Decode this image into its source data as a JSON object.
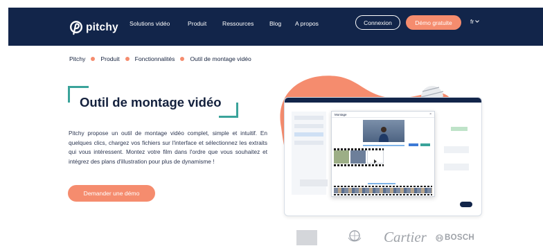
{
  "header": {
    "logo_text": "pitchy",
    "nav": [
      "Solutions vidéo",
      "Produit",
      "Ressources",
      "Blog",
      "A propos"
    ],
    "connexion_label": "Connexion",
    "demo_label": "Démo gratuite",
    "lang_label": "fr",
    "colors": {
      "navbar": "#12254a",
      "accent": "#f58c6e"
    }
  },
  "breadcrumb": [
    "Pitchy",
    "Produit",
    "Fonctionnalités",
    "Outil de montage vidéo"
  ],
  "hero": {
    "title": "Outil de montage vidéo",
    "description": "Pitchy propose un outil de montage vidéo complet, simple et intuitif. En quelques clics, chargez vos fichiers sur l'interface et sélectionnez les extraits qui vous intéressent. Montez votre film dans l'ordre que vous souhaitez et intégrez des plans d'illustration pour plus de dynamisme !",
    "cta_label": "Demander une démo",
    "accent_color": "#3aa39a"
  },
  "illustration": {
    "modal_title": "Montage",
    "close_glyph": "×"
  },
  "clients": {
    "cartier": "Cartier",
    "bosch": "BOSCH"
  }
}
